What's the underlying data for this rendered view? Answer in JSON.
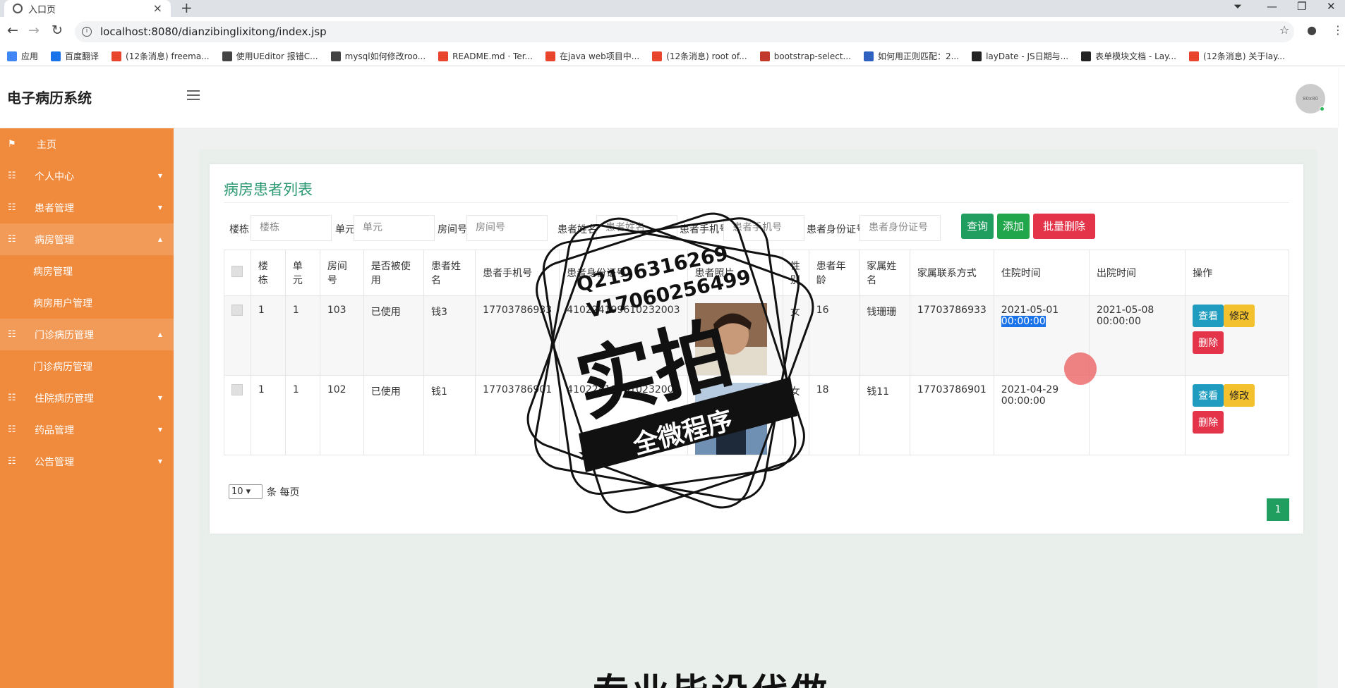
{
  "browser": {
    "tab_title": "入口页",
    "url": "localhost:8080/dianzibinglixitong/index.jsp",
    "bookmarks": [
      "应用",
      "百度翻译",
      "(12条消息) freema...",
      "使用UEditor 报错C...",
      "mysql如何修改roo...",
      "README.md · Ter...",
      "在java web项目中...",
      "(12条消息) root of...",
      "bootstrap-select...",
      "如何用正则匹配：2...",
      "layDate - JS日期与...",
      "表单模块文档 - Lay...",
      "(12条消息) 关于lay..."
    ]
  },
  "app": {
    "brand": "电子病历系统",
    "avatar_text": "80x80"
  },
  "sidebar": {
    "items": [
      {
        "label": "主页"
      },
      {
        "label": "个人中心"
      },
      {
        "label": "患者管理"
      },
      {
        "label": "病房管理"
      },
      {
        "label": "病房管理"
      },
      {
        "label": "病房用户管理"
      },
      {
        "label": "门诊病历管理"
      },
      {
        "label": "门诊病历管理"
      },
      {
        "label": "住院病历管理"
      },
      {
        "label": "药品管理"
      },
      {
        "label": "公告管理"
      }
    ]
  },
  "page": {
    "title": "病房患者列表",
    "search": {
      "building_label": "楼栋",
      "building_ph": "楼栋",
      "unit_label": "单元",
      "unit_ph": "单元",
      "room_label": "房间号",
      "room_ph": "房间号",
      "name_label": "患者姓名",
      "name_ph": "患者姓名",
      "phone_label": "患者手机号",
      "phone_ph": "患者手机号",
      "id_label": "患者身份证号",
      "id_ph": "患者身份证号"
    },
    "buttons": {
      "query": "查询",
      "add": "添加",
      "batch_delete": "批量删除"
    },
    "columns": [
      "楼栋",
      "单元",
      "房间号",
      "是否被使用",
      "患者姓名",
      "患者手机号",
      "患者身份证号",
      "患者照片",
      "性别",
      "患者年龄",
      "家属姓名",
      "家属联系方式",
      "住院时间",
      "出院时间",
      "操作"
    ],
    "rows": [
      {
        "building": "1",
        "unit": "1",
        "room": "103",
        "used": "已使用",
        "name": "钱3",
        "phone": "17703786933",
        "idno": "410224199610232003",
        "gender": "女",
        "age": "16",
        "family": "钱珊珊",
        "family_phone": "17703786933",
        "admit_date": "2021-05-01",
        "admit_time": "00:00:00",
        "discharge_date": "2021-05-08",
        "discharge_time": "00:00:00"
      },
      {
        "building": "1",
        "unit": "1",
        "room": "102",
        "used": "已使用",
        "name": "钱1",
        "phone": "17703786901",
        "idno": "410224199610232001",
        "gender": "女",
        "age": "18",
        "family": "钱11",
        "family_phone": "17703786901",
        "admit_date": "2021-04-29",
        "admit_time": "00:00:00",
        "discharge_date": "",
        "discharge_time": ""
      }
    ],
    "row_buttons": {
      "view": "查看",
      "edit": "修改",
      "delete": "删除"
    },
    "pager": {
      "page_size": "10",
      "per_page": "条 每页",
      "current_page": "1"
    }
  },
  "watermark": {
    "qq": "Q2196316269",
    "v": "V17060256499",
    "big": "实拍",
    "banner": "全微程序"
  },
  "bottom_text": "专业毕设代做"
}
